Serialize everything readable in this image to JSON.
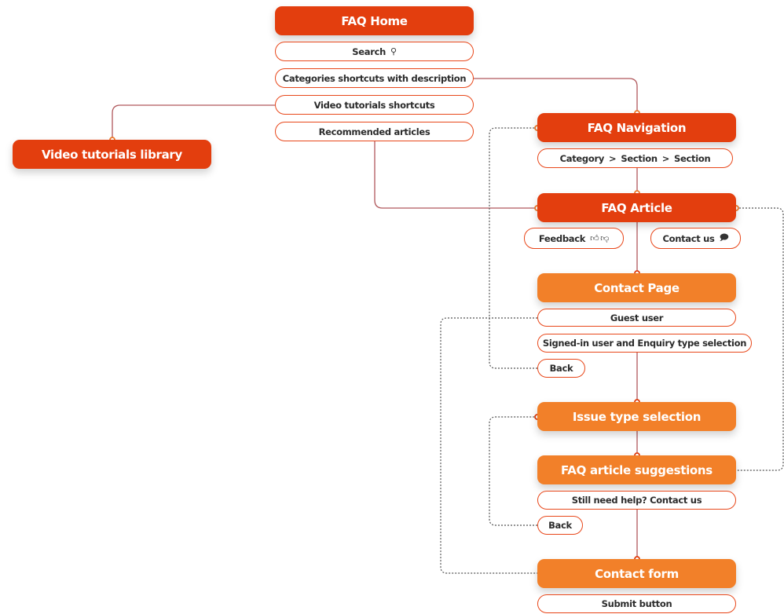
{
  "colors": {
    "primary": "#e33e0e",
    "secondary": "#f28029",
    "connector": "#b0585c",
    "dotted": "#555555"
  },
  "nodes": {
    "faq_home": {
      "title": "FAQ Home",
      "items": [
        "Search",
        "Categories shortcuts with description",
        "Video tutorials shortcuts",
        "Recommended articles"
      ]
    },
    "video_library": {
      "title": "Video tutorials library"
    },
    "faq_navigation": {
      "title": "FAQ Navigation",
      "breadcrumb": [
        "Category",
        "Section",
        "Section"
      ],
      "separator": ">"
    },
    "faq_article": {
      "title": "FAQ Article",
      "feedback": "Feedback",
      "contact_us": "Contact us"
    },
    "contact_page": {
      "title": "Contact Page",
      "items": [
        "Guest user",
        "Signed-in user and Enquiry type selection",
        "Back"
      ]
    },
    "issue_type": {
      "title": "Issue type selection"
    },
    "faq_suggestions": {
      "title": "FAQ article suggestions",
      "items": [
        "Still need help? Contact us",
        "Back"
      ]
    },
    "contact_form": {
      "title": "Contact form",
      "items": [
        "Submit button"
      ]
    }
  },
  "icons": {
    "search": "search-icon",
    "thumbs_up": "thumbs-up-icon",
    "thumbs_down": "thumbs-down-icon",
    "chat": "chat-icon"
  }
}
